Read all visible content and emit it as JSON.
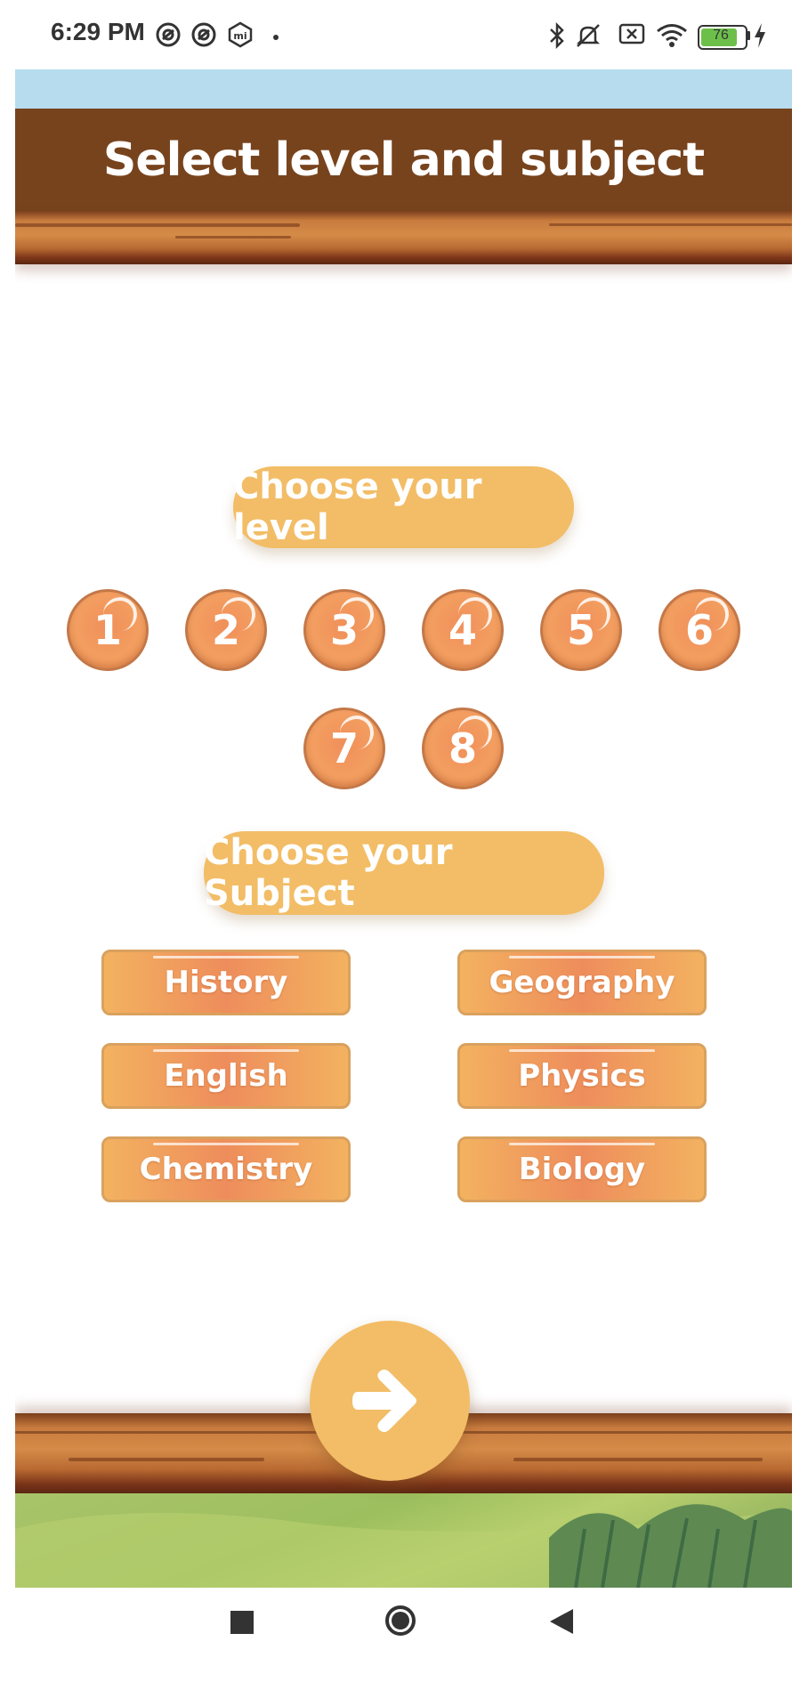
{
  "status_bar": {
    "time": "6:29 PM",
    "battery_level": "76"
  },
  "header": {
    "title": "Select level and subject"
  },
  "level_section": {
    "heading": "Choose your level",
    "levels": [
      "1",
      "2",
      "3",
      "4",
      "5",
      "6",
      "7",
      "8"
    ]
  },
  "subject_section": {
    "heading": "Choose your Subject",
    "subjects": [
      "History",
      "Geography",
      "English",
      "Physics",
      "Chemistry",
      "Biology"
    ]
  },
  "colors": {
    "header_brown": "#77431d",
    "accent_yellow": "#f2bd66",
    "level_orange": "#f39e60",
    "sky_blue": "#b6dcee"
  },
  "icons": {
    "next": "arrow-right-icon",
    "nav_recents": "square-icon",
    "nav_home": "circle-icon",
    "nav_back": "triangle-back-icon"
  }
}
